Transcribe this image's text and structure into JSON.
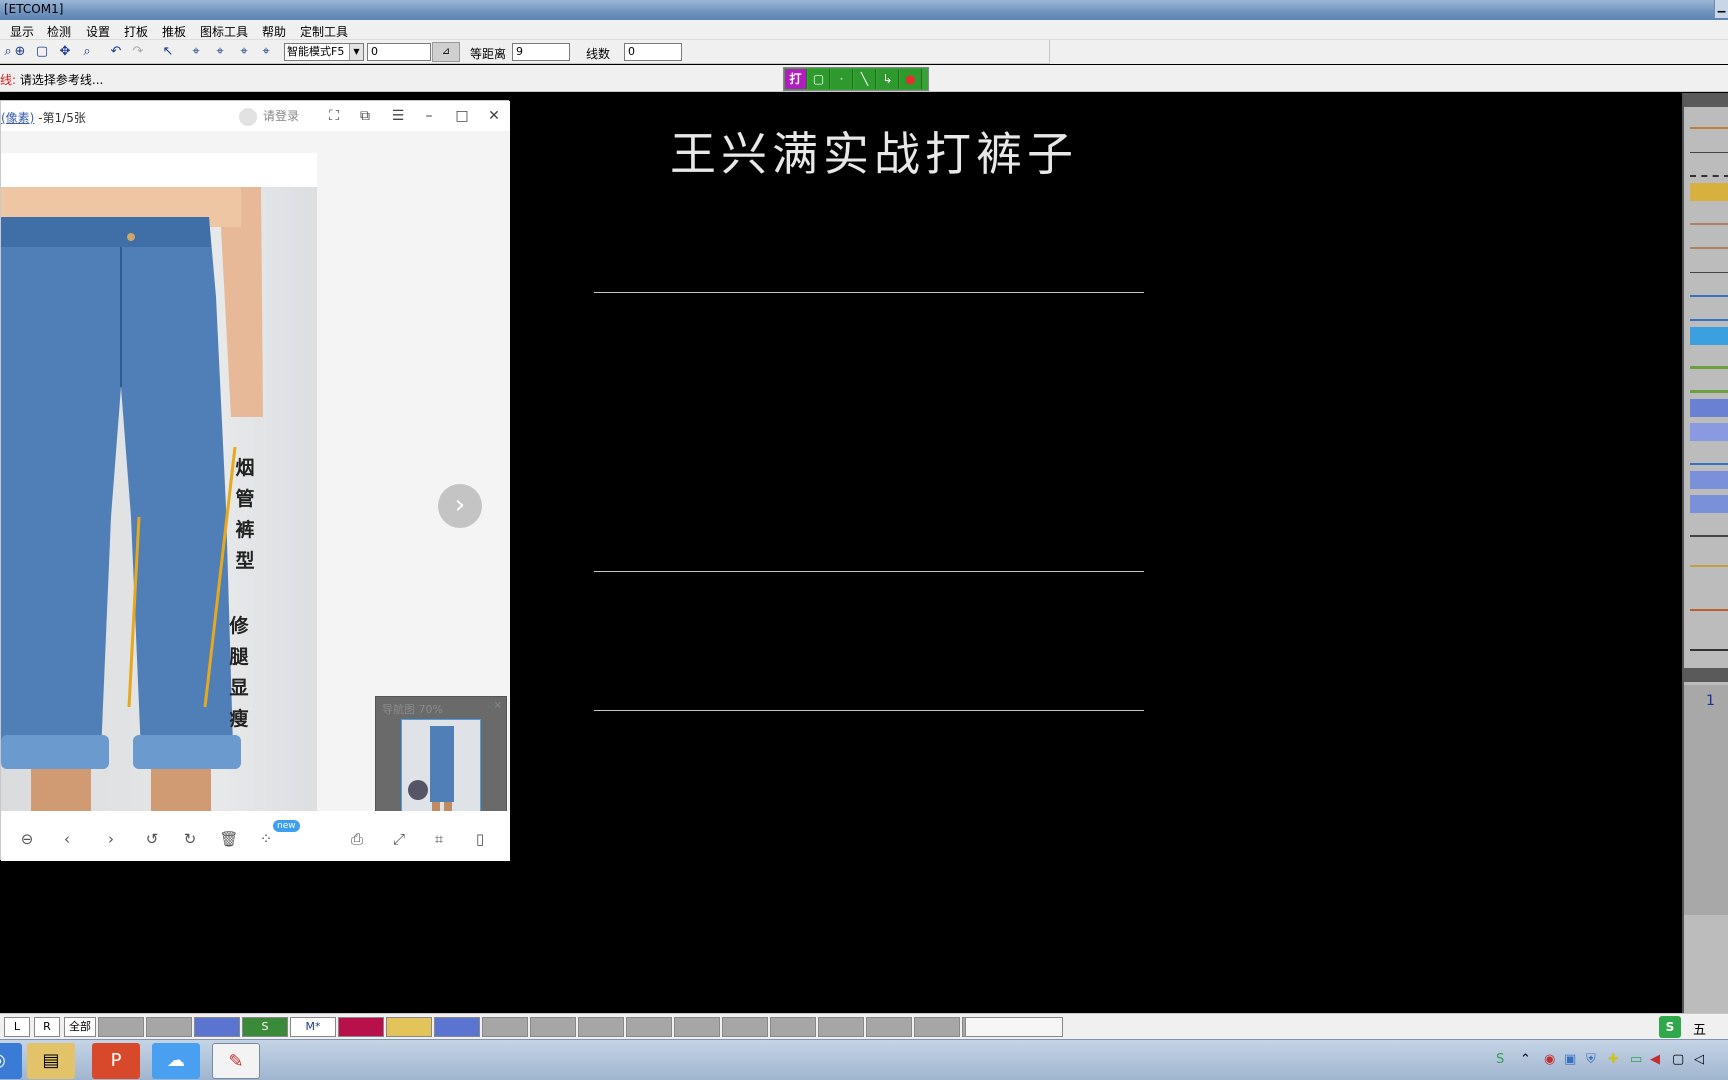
{
  "app": {
    "title": "[ETCOM1]"
  },
  "menu": [
    "显示",
    "检测",
    "设置",
    "打板",
    "推板",
    "图标工具",
    "帮助",
    "定制工具"
  ],
  "toolbar": {
    "mode_select": "智能模式F5",
    "value_input": "0",
    "equal_distance_label": "等距离",
    "equal_distance_value": "9",
    "line_count_label": "线数",
    "line_count_value": "0"
  },
  "status": {
    "prefix": "线:",
    "message": "请选择参考线..."
  },
  "modes": [
    "打",
    "▢",
    "·",
    "╲",
    "↳",
    "●"
  ],
  "canvas": {
    "caption": "王兴满实战打裤子"
  },
  "viewer": {
    "title_link": "(像素)",
    "title_page": " -第1/5张",
    "login": "请登录",
    "photo_text_1": [
      "烟",
      "管",
      "裤",
      "型"
    ],
    "photo_text_2": [
      "修",
      "腿",
      "显",
      "瘦"
    ],
    "thumb_label": "导航图 70%",
    "thumb_close": "×",
    "new_badge": "new"
  },
  "right_panel": {
    "page_number": "1"
  },
  "sizebar": {
    "left": "L",
    "right": "R",
    "all": "全部",
    "sizes": [
      {
        "label": "",
        "color": "#a6a6a6"
      },
      {
        "label": "",
        "color": "#a6a6a6"
      },
      {
        "label": "",
        "color": "#5a74d0"
      },
      {
        "label": "S",
        "color": "#3a8a3a"
      },
      {
        "label": "M*",
        "color": "#ffffff"
      },
      {
        "label": "",
        "color": "#b8104a"
      },
      {
        "label": "",
        "color": "#e2c45a"
      },
      {
        "label": "",
        "color": "#5a74d0"
      },
      {
        "label": "",
        "color": "#a6a6a6"
      },
      {
        "label": "",
        "color": "#a6a6a6"
      },
      {
        "label": "",
        "color": "#a6a6a6"
      },
      {
        "label": "",
        "color": "#a6a6a6"
      },
      {
        "label": "",
        "color": "#a6a6a6"
      },
      {
        "label": "",
        "color": "#a6a6a6"
      },
      {
        "label": "",
        "color": "#a6a6a6"
      },
      {
        "label": "",
        "color": "#a6a6a6"
      },
      {
        "label": "",
        "color": "#a6a6a6"
      },
      {
        "label": "",
        "color": "#a6a6a6"
      },
      {
        "label": "",
        "color": "#a6a6a6"
      }
    ]
  },
  "tray": {
    "ime": "五"
  }
}
